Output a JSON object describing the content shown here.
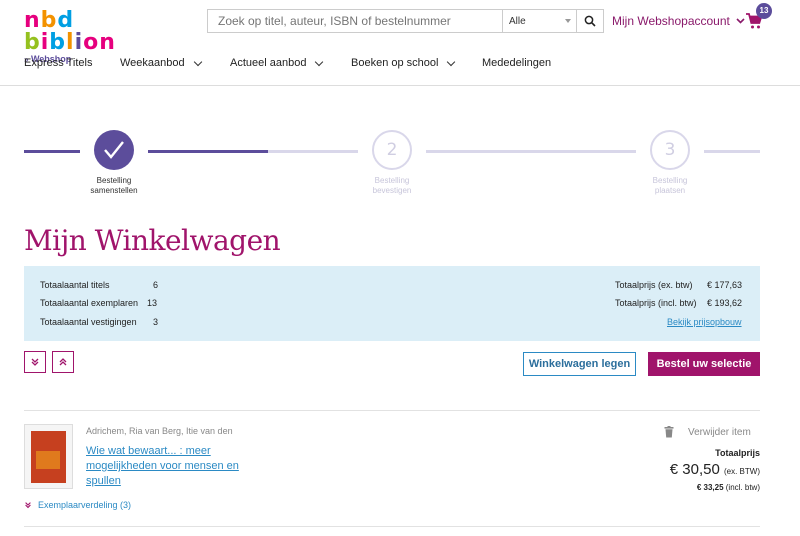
{
  "header": {
    "logo_text": "nbd biblion",
    "logo_sub": "Webshop",
    "search_placeholder": "Zoek op titel, auteur, ISBN of bestelnummer",
    "search_scope": "Alle",
    "account_label": "Mijn Webshopaccount",
    "cart_count": "13"
  },
  "nav": [
    {
      "label": "Express Titels"
    },
    {
      "label": "Weekaanbod"
    },
    {
      "label": "Actueel aanbod"
    },
    {
      "label": "Boeken op school"
    },
    {
      "label": "Mededelingen"
    }
  ],
  "progress": {
    "steps": [
      {
        "number": "",
        "label_1": "Bestelling",
        "label_2": "samenstellen",
        "status": "done"
      },
      {
        "number": "2",
        "label_1": "Bestelling",
        "label_2": "bevestigen",
        "status": "todo"
      },
      {
        "number": "3",
        "label_1": "Bestelling",
        "label_2": "plaatsen",
        "status": "todo"
      }
    ],
    "colors": {
      "active": "#5c4d9b",
      "inactive": "#d9d7ea"
    }
  },
  "page_title": "Mijn Winkelwagen",
  "summary": {
    "left": [
      {
        "label": "Totaalaantal titels",
        "value": "6"
      },
      {
        "label": "Totaalaantal exemplaren",
        "value": "13"
      },
      {
        "label": "Totaalaantal vestigingen",
        "value": "3"
      }
    ],
    "right": [
      {
        "label": "Totaalprijs (ex. btw)",
        "value": "€ 177,63"
      },
      {
        "label": "Totaalprijs (incl. btw)",
        "value": "€ 193,62"
      }
    ],
    "price_breakdown_link": "Bekijk prijsopbouw"
  },
  "actions": {
    "clear_cart": "Winkelwagen legen",
    "order_selection": "Bestel uw selectie"
  },
  "item": {
    "authors": "Adrichem, Ria van Berg, Itie van den",
    "title": "Wie wat bewaart... : meer mogelijkheden voor mensen en spullen",
    "copies_distribution": "Exemplaarverdeling (3)",
    "remove_label": "Verwijder item",
    "total_label": "Totaalprijs",
    "price_ex": "€ 30,50",
    "price_ex_suffix": "(ex. BTW)",
    "price_incl": "€ 33,25",
    "price_incl_suffix": "(incl. btw)"
  },
  "colors": {
    "brand": "#a0146b",
    "link": "#2b8ac4",
    "summary_bg": "#dbeef7"
  }
}
